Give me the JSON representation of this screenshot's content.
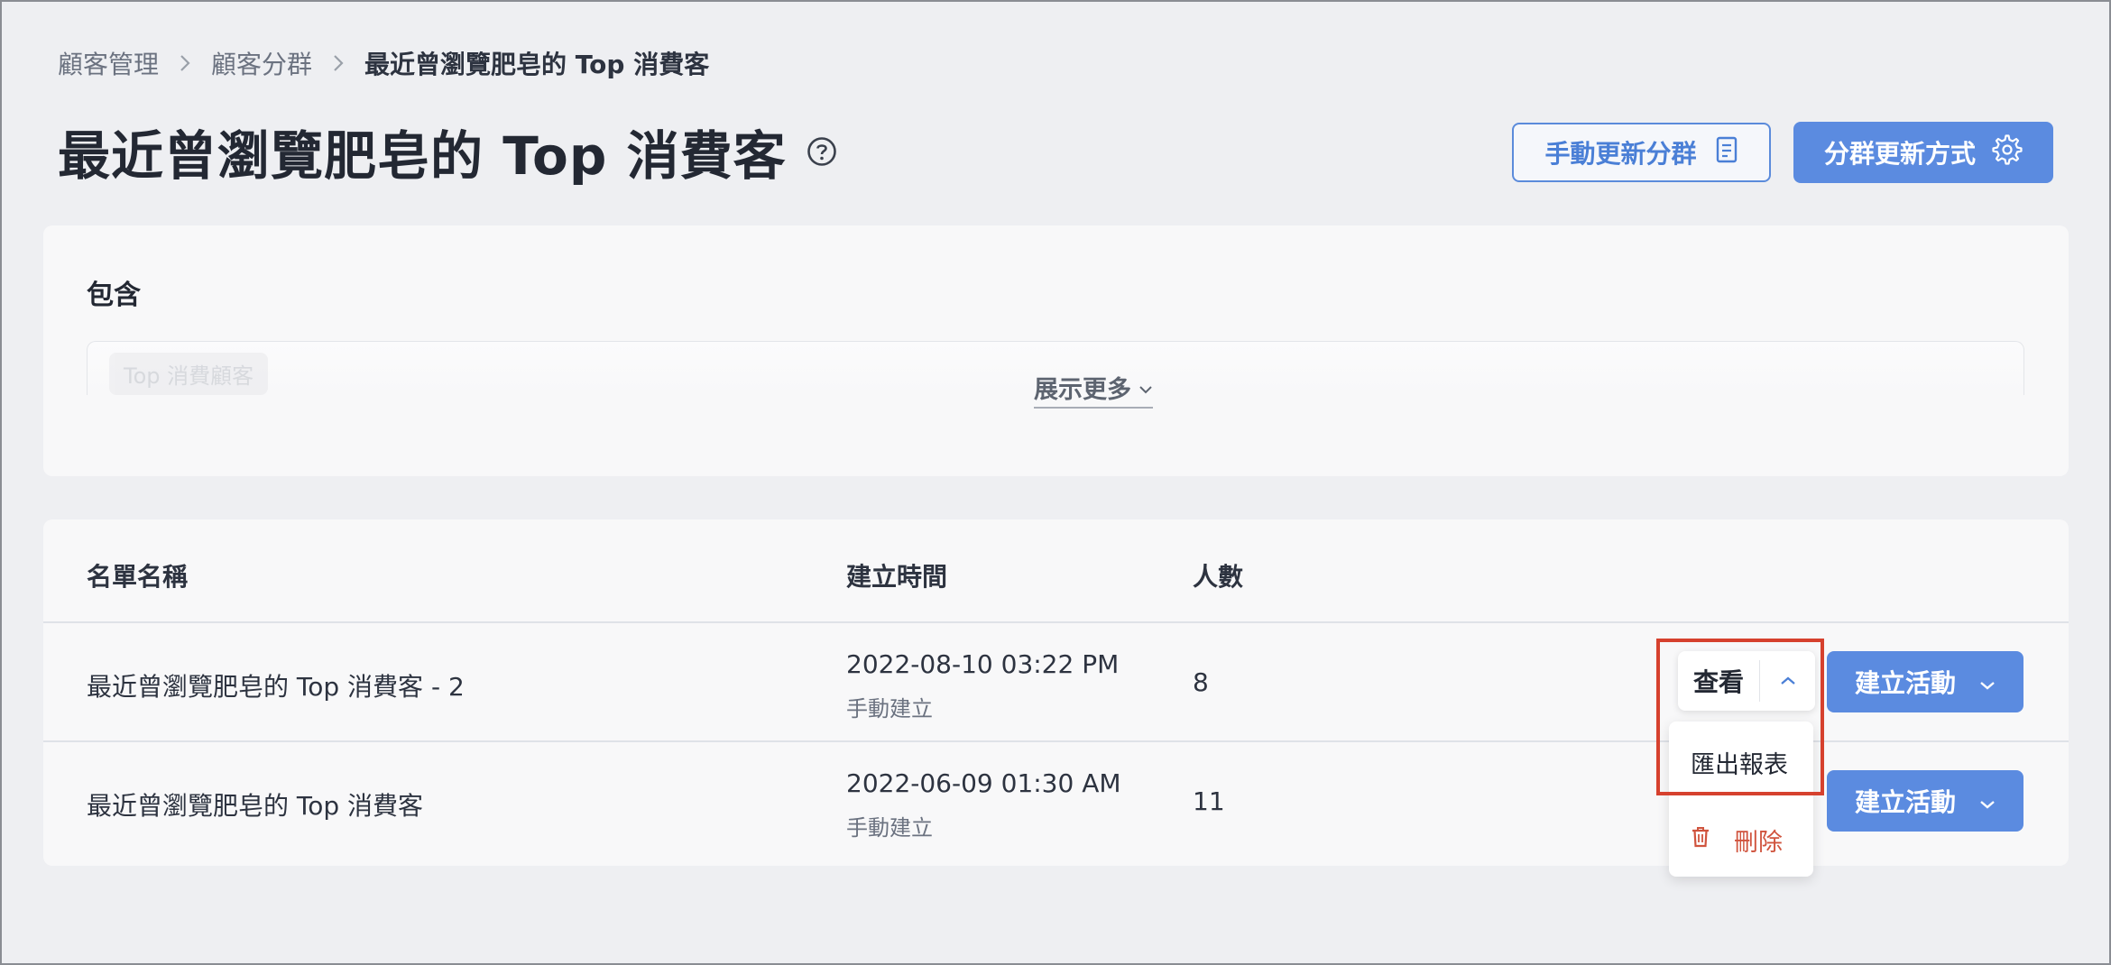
{
  "breadcrumb": {
    "items": [
      "顧客管理",
      "顧客分群"
    ],
    "current": "最近曾瀏覽肥皂的 Top 消費客"
  },
  "page": {
    "title": "最近曾瀏覽肥皂的 Top 消費客"
  },
  "header_actions": {
    "manual_update_label": "手動更新分群",
    "update_method_label": "分群更新方式"
  },
  "include": {
    "title": "包含",
    "tag": "Top 消費顧客",
    "show_more": "展示更多"
  },
  "table": {
    "columns": [
      "名單名稱",
      "建立時間",
      "人數"
    ],
    "rows": [
      {
        "name": "最近曾瀏覽肥皂的 Top 消費客 - 2",
        "created": "2022-08-10 03:22 PM",
        "created_by": "手動建立",
        "count": "8",
        "action": "建立活動"
      },
      {
        "name": "最近曾瀏覽肥皂的 Top 消費客",
        "created": "2022-06-09 01:30 AM",
        "created_by": "手動建立",
        "count": "11",
        "action": "建立活動"
      }
    ]
  },
  "split_button": {
    "label": "查看"
  },
  "dropdown": {
    "export_label": "匯出報表",
    "delete_label": "刪除"
  },
  "colors": {
    "primary": "#5b8be0",
    "danger": "#d0543e",
    "highlight": "#d6412e"
  }
}
